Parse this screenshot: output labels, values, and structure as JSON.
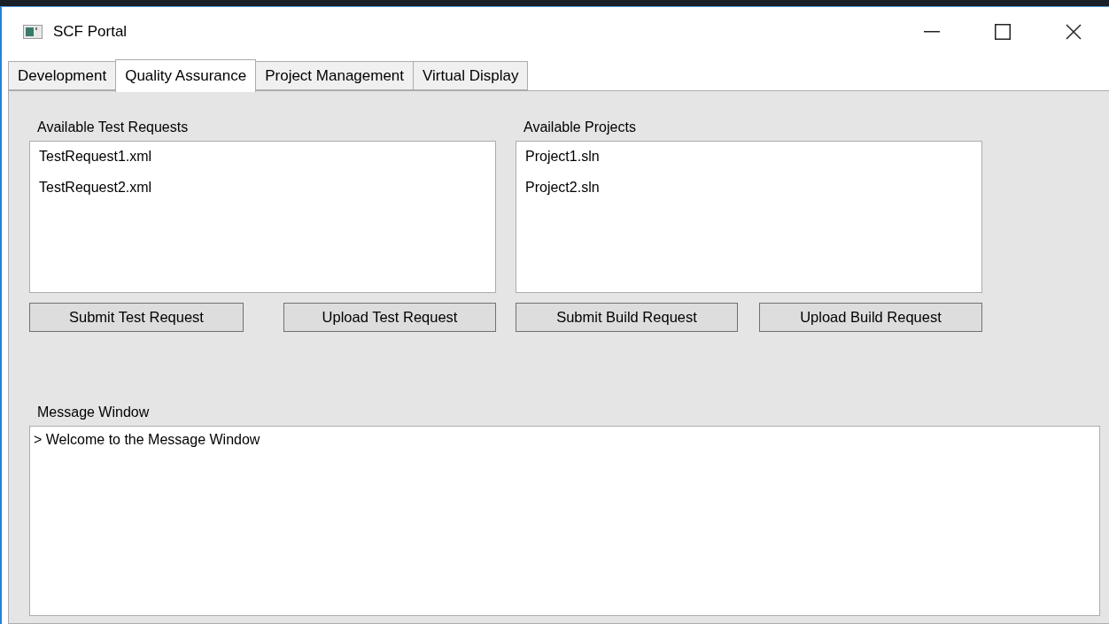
{
  "window": {
    "title": "SCF Portal"
  },
  "tabs": [
    {
      "label": "Development",
      "selected": false
    },
    {
      "label": "Quality Assurance",
      "selected": true
    },
    {
      "label": "Project Management",
      "selected": false
    },
    {
      "label": "Virtual Display",
      "selected": false
    }
  ],
  "test_requests": {
    "label": "Available Test Requests",
    "items": [
      "TestRequest1.xml",
      "TestRequest2.xml"
    ],
    "buttons": [
      "Submit Test Request",
      "Upload Test Request"
    ]
  },
  "projects": {
    "label": "Available Projects",
    "items": [
      "Project1.sln",
      "Project2.sln"
    ],
    "buttons": [
      "Submit Build Request",
      "Upload Build Request"
    ]
  },
  "message_window": {
    "label": "Message Window",
    "lines": [
      "> Welcome to the Message Window"
    ]
  }
}
